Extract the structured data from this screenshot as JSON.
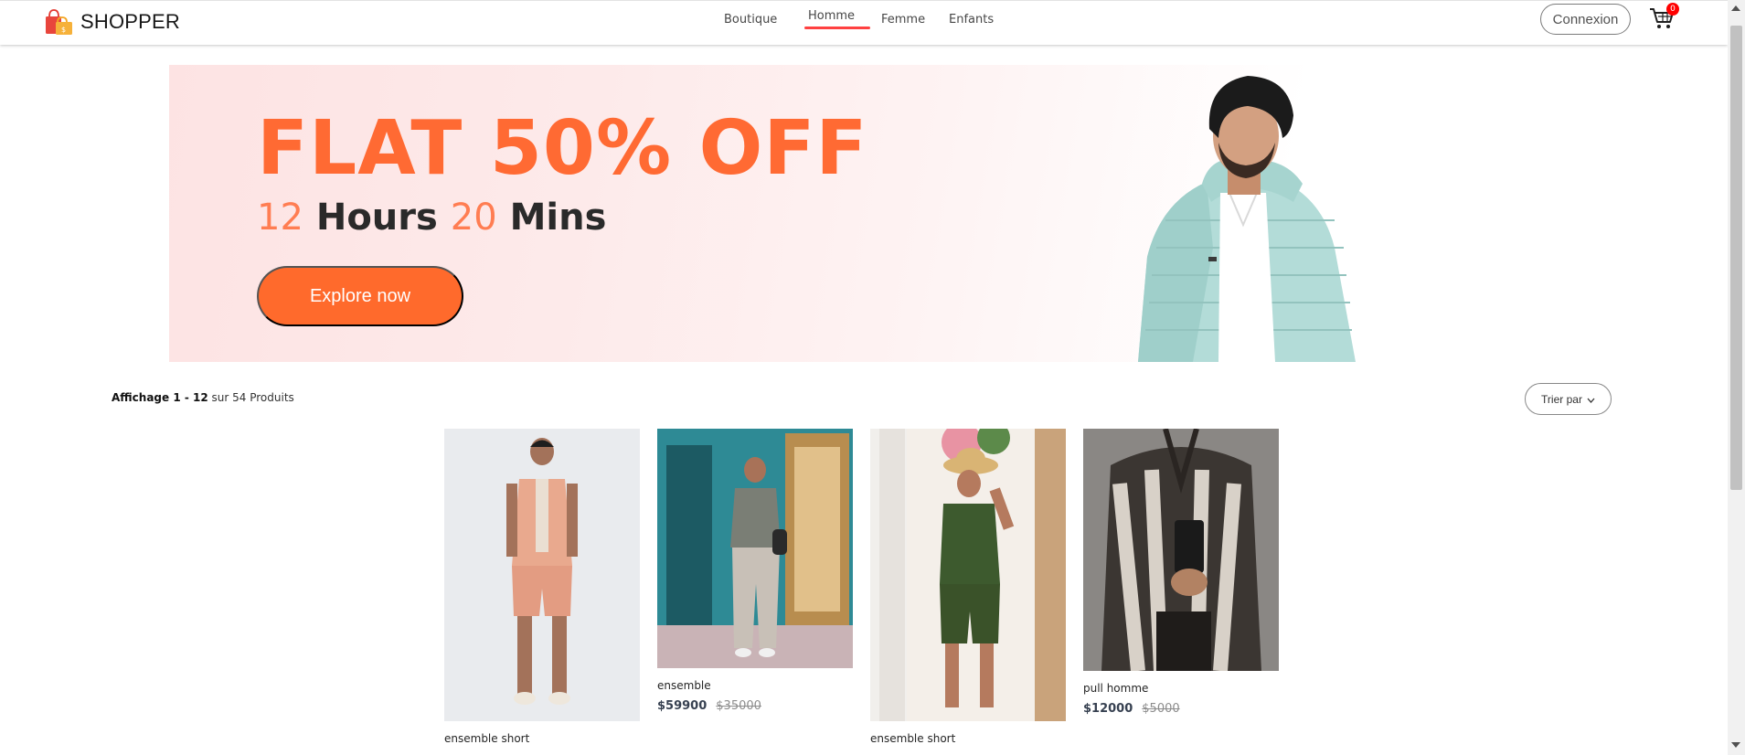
{
  "brand": {
    "name": "SHOPPER",
    "logo_icon": "shopping-bags-icon"
  },
  "nav": {
    "items": [
      {
        "label": "Boutique",
        "active": false
      },
      {
        "label": "Homme",
        "active": true
      },
      {
        "label": "Femme",
        "active": false
      },
      {
        "label": "Enfants",
        "active": false
      }
    ],
    "login_label": "Connexion",
    "cart_icon": "cart-icon",
    "cart_count": "0",
    "accent_color": "#ff4141"
  },
  "hero": {
    "headline": "FLAT 50% OFF",
    "timer": {
      "hours": "12",
      "hours_label": "Hours",
      "mins": "20",
      "mins_label": "Mins"
    },
    "cta_label": "Explore now",
    "cta_color": "#ff6a2c"
  },
  "listing": {
    "showing_prefix": "Affichage 1 - 12",
    "showing_suffix": "sur 54 Produits",
    "sort_label": "Trier par",
    "sort_icon": "chevron-down-icon"
  },
  "products": [
    {
      "name": "ensemble short",
      "price_new": "",
      "price_old": ""
    },
    {
      "name": "ensemble",
      "price_new": "$59900",
      "price_old": "$35000"
    },
    {
      "name": "ensemble short",
      "price_new": "",
      "price_old": ""
    },
    {
      "name": "pull homme",
      "price_new": "$12000",
      "price_old": "$5000"
    }
  ]
}
